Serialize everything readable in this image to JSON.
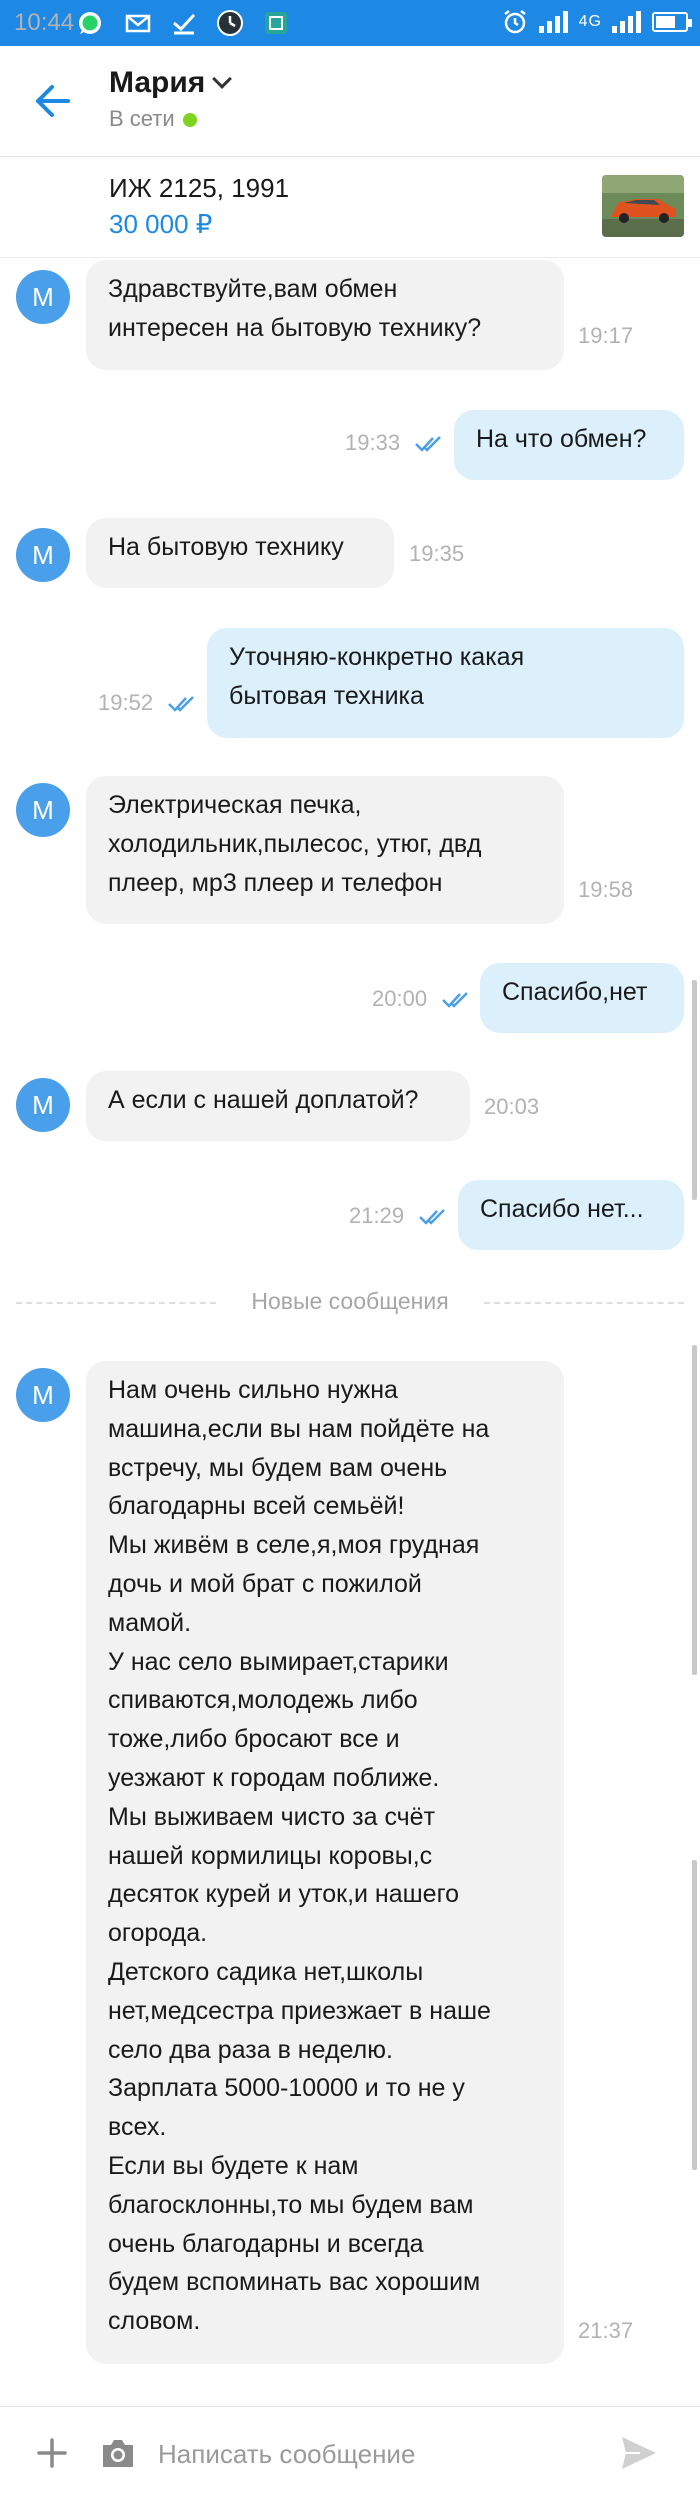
{
  "status_bar": {
    "time": "10:44",
    "signal": "4G",
    "icons": [
      "whatsapp-icon",
      "gmail-icon",
      "checkmark-icon",
      "clock-app-icon",
      "screenshot-icon",
      "alarm-icon",
      "signal-icon",
      "battery-icon"
    ]
  },
  "header": {
    "contact_name": "Мария",
    "presence": "В сети",
    "online_color": "#7ed321",
    "accent_color": "#1e88e5"
  },
  "ad": {
    "title": "ИЖ 2125, 1991",
    "price": "30 000 ₽"
  },
  "avatar_letter": "M",
  "messages": [
    {
      "dir": "in",
      "text": "Здравствуйте,вам обмен\nинтересен на бытовую технику?",
      "time": "19:17"
    },
    {
      "dir": "out",
      "text": "На что обмен?",
      "time": "19:33",
      "read": true
    },
    {
      "dir": "in",
      "text": "На бытовую технику",
      "time": "19:35"
    },
    {
      "dir": "out",
      "text": "Уточняю-конкретно какая\nбытовая техника",
      "time": "19:52",
      "read": true
    },
    {
      "dir": "in",
      "text": "Электрическая печка,\nхолодильник,пылесос, утюг, двд\nплеер, мр3 плеер и телефон",
      "time": "19:58"
    },
    {
      "dir": "out",
      "text": "Спасибо,нет",
      "time": "20:00",
      "read": true
    },
    {
      "dir": "in",
      "text": "А если с нашей доплатой?",
      "time": "20:03"
    },
    {
      "dir": "out",
      "text": "Спасибо нет...",
      "time": "21:29",
      "read": true
    },
    {
      "dir": "in",
      "text": "Нам очень сильно нужна\nмашина,если вы нам пойдёте на\nвстречу, мы будем вам очень\nблагодарны всей семьёй!\nМы живём в селе,я,моя грудная\nдочь и мой брат с пожилой\nмамой.\nУ нас село вымирает,старики\nспиваются,молодежь либо\nтоже,либо бросают все и\nуезжают к городам поближе.\nМы выживаем чисто за счёт\nнашей кормилицы коровы,с\nдесяток курей и уток,и нашего\nогорода.\nДетского садика нет,школы\nнет,медсестра приезжает в наше\nсело два раза в неделю.\nЗарплата 5000-10000 и то не у\nвсех.\nЕсли вы будете к нам\nблагосклонны,то мы будем вам\nочень благодарны и всегда\nбудем вспоминать вас хорошим\nсловом.",
      "time": "21:37"
    }
  ],
  "new_messages_separator": "Новые сообщения",
  "composer": {
    "placeholder": "Написать сообщение"
  }
}
